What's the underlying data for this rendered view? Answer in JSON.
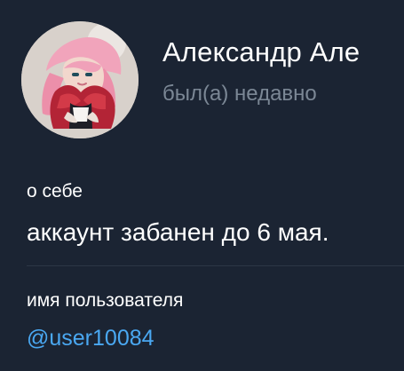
{
  "profile": {
    "name": "Александр Але",
    "status": "был(а) недавно",
    "avatar_icon": "profile-avatar"
  },
  "about": {
    "label": "о себе",
    "text": "аккаунт забанен до 6 мая."
  },
  "username": {
    "label": "имя пользователя",
    "value": "@user10084"
  },
  "colors": {
    "background": "#1b2433",
    "primary_text": "#ffffff",
    "secondary_text": "#7b8795",
    "link": "#4aa8f2",
    "divider": "#2c3646"
  }
}
